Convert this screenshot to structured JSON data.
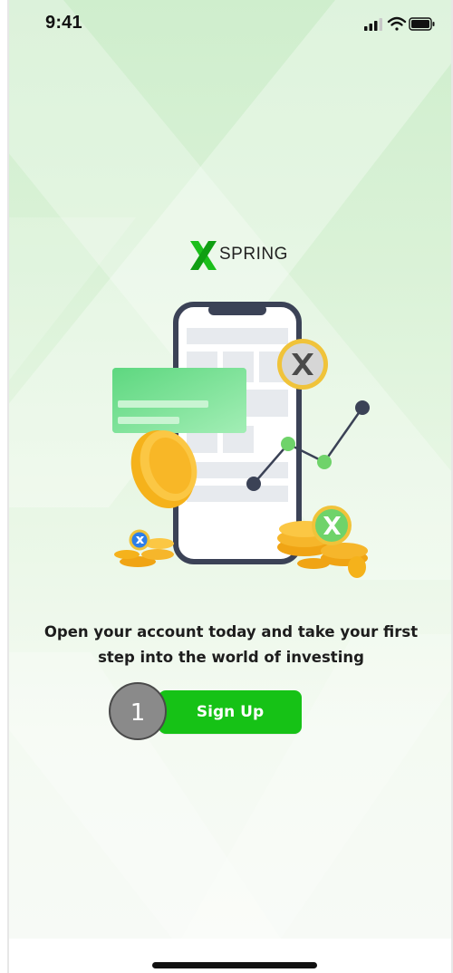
{
  "status_bar": {
    "time": "9:41"
  },
  "brand": {
    "logo_letter": "X",
    "logo_text": "SPRING",
    "accent_color": "#16c216"
  },
  "onboarding": {
    "headline_line1": "Open your account today and take your first",
    "headline_line2": "step into the world of investing",
    "signup_label": "Sign Up"
  },
  "annotation": {
    "step_number": "1"
  },
  "icons": {
    "signal": "cellular-signal-icon",
    "wifi": "wifi-icon",
    "battery": "battery-icon",
    "coin_x": "x-coin-icon"
  }
}
